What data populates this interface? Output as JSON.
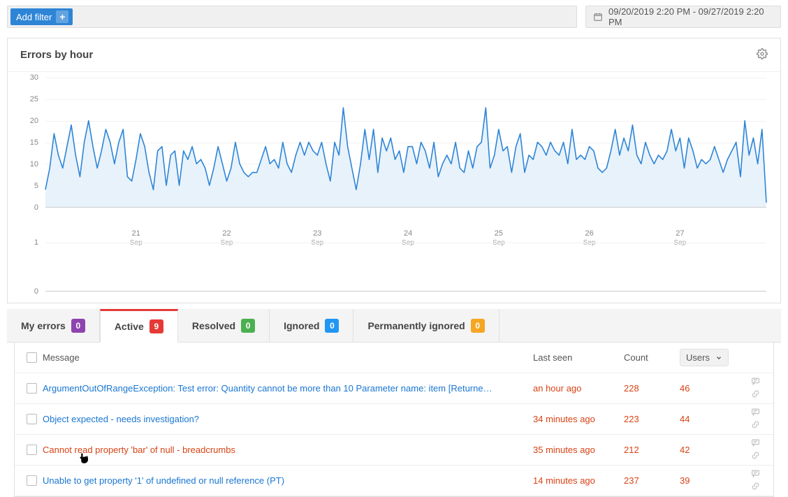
{
  "top": {
    "add_filter_label": "Add filter",
    "date_range": "09/20/2019 2:20 PM - 09/27/2019 2:20 PM"
  },
  "card": {
    "title": "Errors by hour"
  },
  "chart_data": {
    "type": "line",
    "title": "Errors by hour",
    "ylabel": "",
    "xlabel": "",
    "ylim": [
      0,
      30
    ],
    "y_ticks": [
      0,
      5,
      10,
      15,
      20,
      25,
      30
    ],
    "x_day_labels": [
      "21",
      "22",
      "23",
      "24",
      "25",
      "26",
      "27"
    ],
    "x_sub_label": "Sep",
    "values": [
      4,
      9,
      17,
      12,
      9,
      14,
      19,
      12,
      7,
      15,
      20,
      14,
      9,
      13,
      18,
      15,
      10,
      15,
      18,
      7,
      6,
      11,
      17,
      14,
      8,
      4,
      13,
      14,
      5,
      12,
      13,
      5,
      13,
      11,
      14,
      10,
      11,
      9,
      5,
      9,
      14,
      10,
      6,
      9,
      15,
      10,
      8,
      7,
      8,
      8,
      11,
      14,
      10,
      11,
      9,
      15,
      10,
      8,
      12,
      15,
      12,
      15,
      13,
      12,
      15,
      10,
      6,
      15,
      12,
      23,
      14,
      9,
      4,
      10,
      18,
      11,
      18,
      8,
      16,
      13,
      16,
      11,
      13,
      8,
      14,
      14,
      10,
      15,
      13,
      9,
      15,
      7,
      10,
      12,
      10,
      15,
      9,
      8,
      13,
      9,
      14,
      15,
      23,
      9,
      12,
      18,
      13,
      14,
      8,
      14,
      17,
      8,
      12,
      11,
      15,
      14,
      12,
      15,
      13,
      12,
      15,
      10,
      18,
      11,
      12,
      11,
      14,
      13,
      9,
      8,
      9,
      13,
      18,
      12,
      16,
      13,
      19,
      12,
      10,
      15,
      12,
      10,
      12,
      11,
      13,
      18,
      13,
      16,
      9,
      16,
      13,
      9,
      11,
      10,
      11,
      14,
      11,
      8,
      11,
      13,
      15,
      7,
      20,
      12,
      16,
      10,
      18,
      1
    ],
    "mini_ylim": [
      0,
      1
    ],
    "mini_y_ticks": [
      0,
      1
    ]
  },
  "tabs": [
    {
      "label": "My errors",
      "badge": "0",
      "color": "purple",
      "active": false
    },
    {
      "label": "Active",
      "badge": "9",
      "color": "red",
      "active": true
    },
    {
      "label": "Resolved",
      "badge": "0",
      "color": "green",
      "active": false
    },
    {
      "label": "Ignored",
      "badge": "0",
      "color": "blue",
      "active": false
    },
    {
      "label": "Permanently ignored",
      "badge": "0",
      "color": "orange",
      "active": false
    }
  ],
  "table": {
    "columns": {
      "message": "Message",
      "last_seen": "Last seen",
      "count": "Count",
      "users": "Users"
    },
    "rows": [
      {
        "message": "ArgumentOutOfRangeException: Test error: Quantity cannot be more than 10 Parameter name: item [Returne…",
        "last_seen": "an hour ago",
        "count": "228",
        "users": "46",
        "hovered": false
      },
      {
        "message": "Object expected - needs investigation?",
        "last_seen": "34 minutes ago",
        "count": "223",
        "users": "44",
        "hovered": false
      },
      {
        "message": "Cannot read property 'bar' of null - breadcrumbs",
        "last_seen": "35 minutes ago",
        "count": "212",
        "users": "42",
        "hovered": true
      },
      {
        "message": "Unable to get property '1' of undefined or null reference (PT)",
        "last_seen": "14 minutes ago",
        "count": "237",
        "users": "39",
        "hovered": false
      }
    ]
  }
}
